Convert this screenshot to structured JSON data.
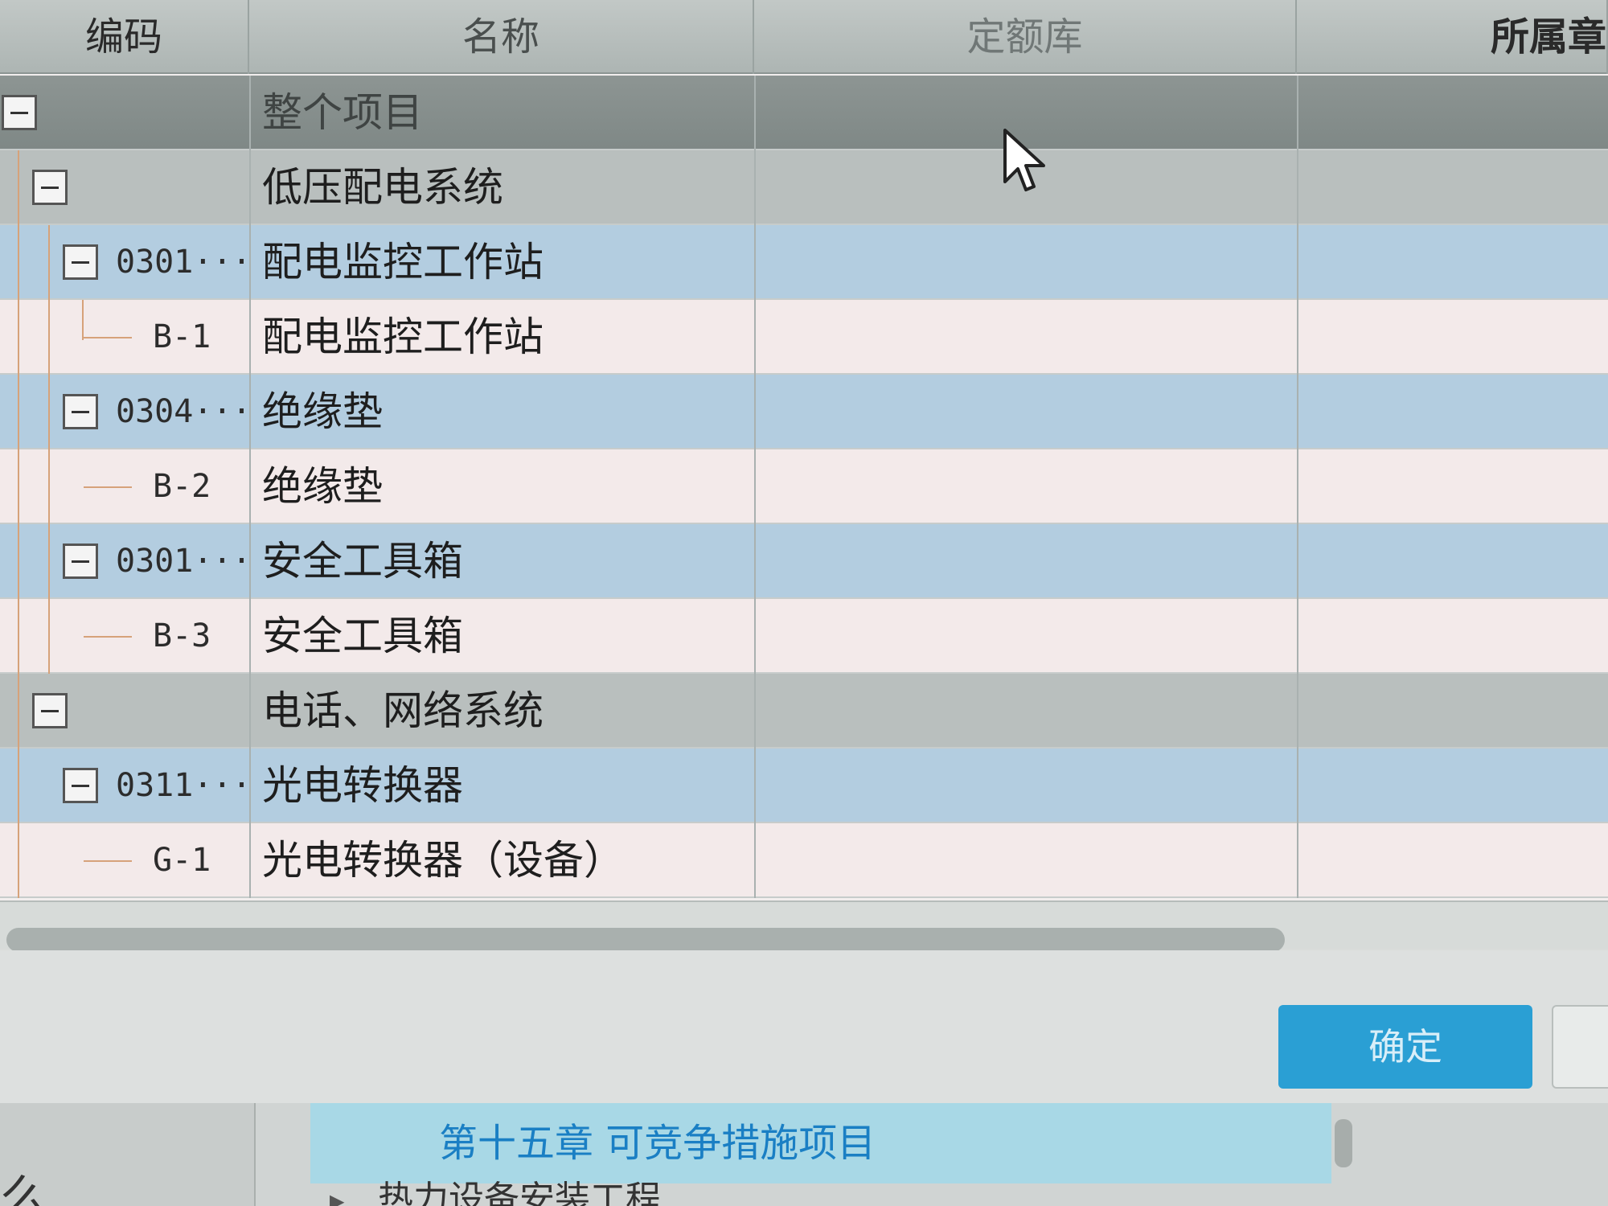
{
  "columns": {
    "code": "编码",
    "name": "名称",
    "quota_lib": "定额库",
    "chapter": "所属章"
  },
  "rows": [
    {
      "type": "project",
      "code": "",
      "name": "整个项目"
    },
    {
      "type": "system",
      "code": "",
      "name": "低压配电系统"
    },
    {
      "type": "item",
      "code": "0301···",
      "name": "配电监控工作站"
    },
    {
      "type": "quota",
      "code": "B-1",
      "name": "配电监控工作站"
    },
    {
      "type": "item",
      "code": "0304···",
      "name": "绝缘垫"
    },
    {
      "type": "quota",
      "code": "B-2",
      "name": "绝缘垫"
    },
    {
      "type": "item",
      "code": "0301···",
      "name": "安全工具箱"
    },
    {
      "type": "quota",
      "code": "B-3",
      "name": "安全工具箱"
    },
    {
      "type": "system",
      "code": "",
      "name": "电话、网络系统"
    },
    {
      "type": "item",
      "code": "0311···",
      "name": "光电转换器"
    },
    {
      "type": "quota",
      "code": "G-1",
      "name": "光电转换器（设备）"
    }
  ],
  "buttons": {
    "ok": "确定"
  },
  "background_window": {
    "selected_item": "第十五章 可竞争措施项目",
    "next_item": "热力设备安装工程",
    "left_char": "么"
  },
  "colors": {
    "accent": "#2a9fd4",
    "item_row": "#b3cde0",
    "quota_row": "#f3eaea",
    "system_row": "#b9bfbe"
  }
}
